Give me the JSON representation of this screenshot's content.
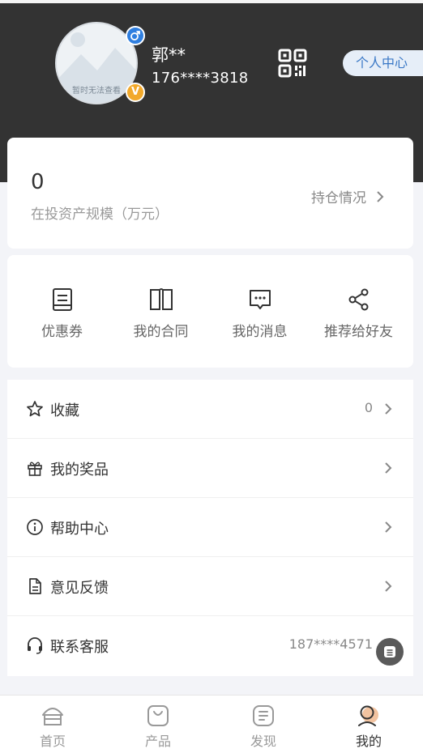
{
  "header": {
    "avatar_placeholder": "暂时无法查看",
    "user_name": "郭**",
    "user_phone": "176****3818",
    "vip_badge": "V",
    "personal_center_label": "个人中心"
  },
  "assets": {
    "value": "0",
    "label": "在投资产规模（万元）",
    "holdings_label": "持仓情况"
  },
  "shortcuts": [
    {
      "label": "优惠券",
      "icon": "coupon-icon"
    },
    {
      "label": "我的合同",
      "icon": "contract-book-icon"
    },
    {
      "label": "我的消息",
      "icon": "message-icon"
    },
    {
      "label": "推荐给好友",
      "icon": "share-icon"
    }
  ],
  "menu": [
    {
      "label": "收藏",
      "value": "0",
      "icon": "star-icon"
    },
    {
      "label": "我的奖品",
      "value": "",
      "icon": "gift-icon"
    },
    {
      "label": "帮助中心",
      "value": "",
      "icon": "info-icon"
    },
    {
      "label": "意见反馈",
      "value": "",
      "icon": "document-icon"
    },
    {
      "label": "联系客服",
      "value": "187****4571",
      "icon": "headset-icon"
    }
  ],
  "tabs": [
    {
      "label": "首页",
      "icon": "home-icon",
      "active": false
    },
    {
      "label": "产品",
      "icon": "product-bag-icon",
      "active": false
    },
    {
      "label": "发现",
      "icon": "discover-icon",
      "active": false
    },
    {
      "label": "我的",
      "icon": "profile-icon",
      "active": true
    }
  ],
  "colors": {
    "header_bg": "#333333",
    "accent_blue": "#2f7fe0",
    "vip_gold": "#f2a92b",
    "page_bg": "#f3f4f8"
  }
}
